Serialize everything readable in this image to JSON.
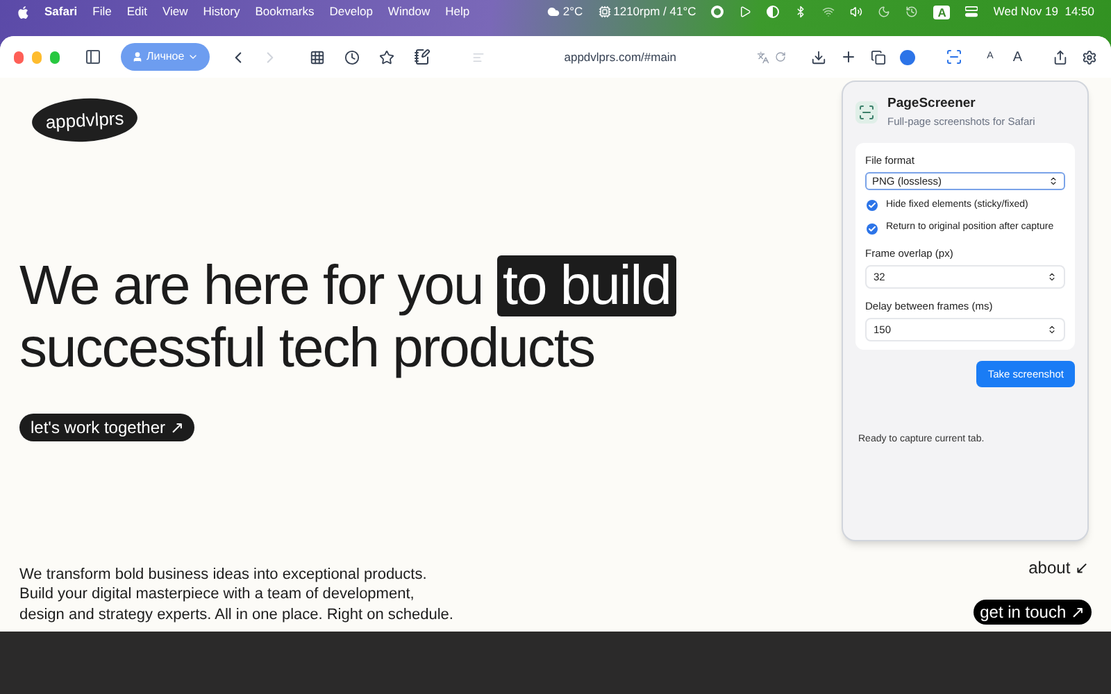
{
  "menu_bar": {
    "app": "Safari",
    "items": [
      "File",
      "Edit",
      "View",
      "History",
      "Bookmarks",
      "Develop",
      "Window",
      "Help"
    ],
    "weather": "2°C",
    "fan": "1210rpm / 41°C",
    "input_source": "A",
    "clock": "Wed Nov 19  14:50"
  },
  "toolbar": {
    "profile": "Личное",
    "address": "appdvlprs.com/#main",
    "font_small": "A",
    "font_large": "A"
  },
  "page": {
    "logo": "appdvlprs",
    "headline": [
      {
        "text": "We are here for you ",
        "highlight": false
      },
      {
        "text": "to build",
        "highlight": true
      },
      {
        "text": "successful tech products",
        "highlight": false,
        "newline": true
      }
    ],
    "cta": "let's work together ↗",
    "body_lines": [
      "We transform bold business ideas into exceptional products.",
      "Build your digital masterpiece with a team of development,",
      "design and strategy experts. All in one place. Right on schedule."
    ],
    "about_link": "about ↙",
    "contact_button": "get in touch ↗"
  },
  "popup": {
    "title": "PageScreener",
    "subtitle": "Full-page screenshots for Safari",
    "file_format": {
      "label": "File format",
      "value": "PNG (lossless)"
    },
    "options": [
      {
        "label": "Hide fixed elements (sticky/fixed)",
        "checked": true
      },
      {
        "label": "Return to original position after capture",
        "checked": true
      }
    ],
    "overlap": {
      "label": "Frame overlap (px)",
      "value": "32"
    },
    "delay": {
      "label": "Delay between frames (ms)",
      "value": "150"
    },
    "button": "Take screenshot",
    "status": "Ready to capture current tab."
  }
}
